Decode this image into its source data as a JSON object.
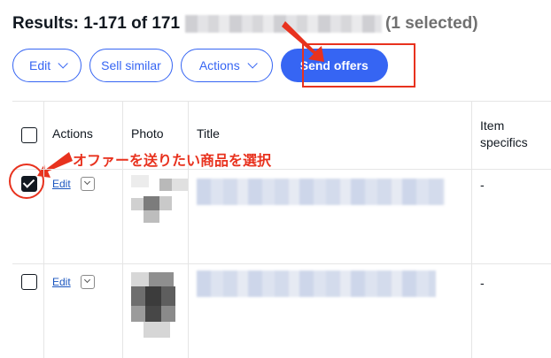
{
  "header": {
    "results_text": "Results: 1-171 of 171",
    "selected_text": "(1 selected)"
  },
  "toolbar": {
    "edit_label": "Edit",
    "sell_similar_label": "Sell similar",
    "actions_label": "Actions",
    "send_offers_label": "Send offers"
  },
  "table": {
    "columns": [
      "Actions",
      "Photo",
      "Title",
      "Item specifics"
    ],
    "rows": [
      {
        "selected": true,
        "edit_label": "Edit",
        "item_specifics": "-"
      },
      {
        "selected": false,
        "edit_label": "Edit",
        "item_specifics": "-"
      }
    ]
  },
  "annotation": {
    "text": "オファーを送りたい商品を選択"
  },
  "colors": {
    "accent": "#3665f3",
    "annotation_red": "#e8321e",
    "text": "#111820"
  }
}
